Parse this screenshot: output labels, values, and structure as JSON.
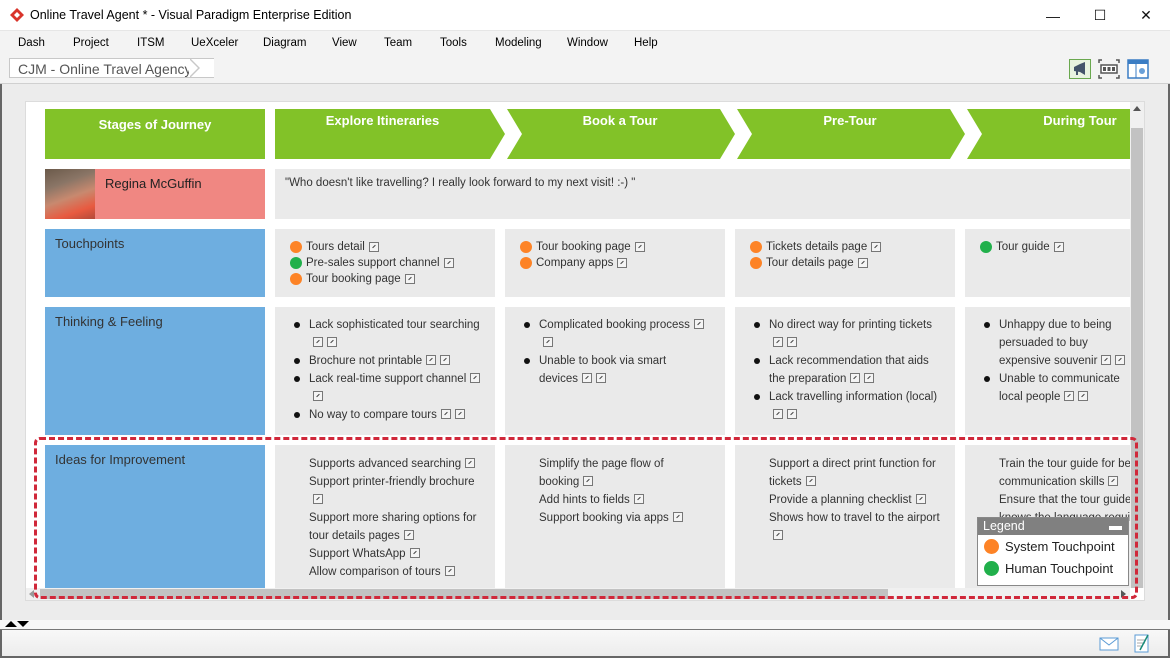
{
  "window": {
    "title": "Online Travel Agent * - Visual Paradigm Enterprise Edition",
    "minimize": "—",
    "maximize": "☐",
    "close": "✕"
  },
  "menu": [
    "Dash",
    "Project",
    "ITSM",
    "UeXceler",
    "Diagram",
    "View",
    "Team",
    "Tools",
    "Modeling",
    "Window",
    "Help"
  ],
  "breadcrumb": "CJM - Online Travel Agency",
  "colors": {
    "stage_green": "#82c228",
    "persona_red": "#f08782",
    "row_blue": "#6eaee0",
    "system_touchpoint": "#fd8326",
    "human_touchpoint": "#21b04b",
    "highlight_dash": "#d0283a"
  },
  "journey": {
    "stages_header": "Stages of Journey",
    "stages": [
      "Explore Itineraries",
      "Book a Tour",
      "Pre-Tour",
      "During Tour"
    ],
    "persona": {
      "name": "Regina McGuffin",
      "quote": "\"Who doesn't like travelling? I really look forward to my next visit! :-) \""
    },
    "rows": {
      "touchpoints": "Touchpoints",
      "thinking": "Thinking & Feeling",
      "ideas": "Ideas for Improvement"
    },
    "touchpoints": [
      [
        {
          "label": "Tours detail",
          "type": "system"
        },
        {
          "label": "Pre-sales support channel",
          "type": "human"
        },
        {
          "label": "Tour booking page",
          "type": "system"
        }
      ],
      [
        {
          "label": "Tour booking page",
          "type": "system"
        },
        {
          "label": "Company apps",
          "type": "system"
        }
      ],
      [
        {
          "label": "Tickets details page",
          "type": "system"
        },
        {
          "label": "Tour details page",
          "type": "system"
        }
      ],
      [
        {
          "label": "Tour guide",
          "type": "human"
        }
      ]
    ],
    "thinking": [
      [
        "Lack sophisticated tour searching",
        "Brochure not printable",
        "Lack real-time support channel",
        "No way to compare tours"
      ],
      [
        "Complicated booking process",
        "Unable to book via smart devices"
      ],
      [
        "No direct way for printing tickets",
        "Lack recommendation that aids the preparation",
        "Lack travelling information (local)"
      ],
      [
        "Unhappy due to being persuaded to buy expensive souvenir",
        "Unable to communicate local people"
      ]
    ],
    "ideas": [
      [
        "Supports advanced searching",
        "Support printer-friendly brochure",
        "Support more sharing options for tour details pages",
        "Support WhatsApp",
        "Allow comparison of tours"
      ],
      [
        "Simplify the page flow of booking",
        "Add hints to fields",
        "Support booking via apps"
      ],
      [
        "Support a direct print function for tickets",
        "Provide a planning checklist",
        "Shows how to travel to the airport"
      ],
      [
        "Train the tour guide for better communication skills",
        "Ensure that the tour guide knows the language required"
      ]
    ]
  },
  "legend": {
    "title": "Legend",
    "items": [
      {
        "label": "System Touchpoint",
        "type": "system"
      },
      {
        "label": "Human Touchpoint",
        "type": "human"
      }
    ]
  }
}
